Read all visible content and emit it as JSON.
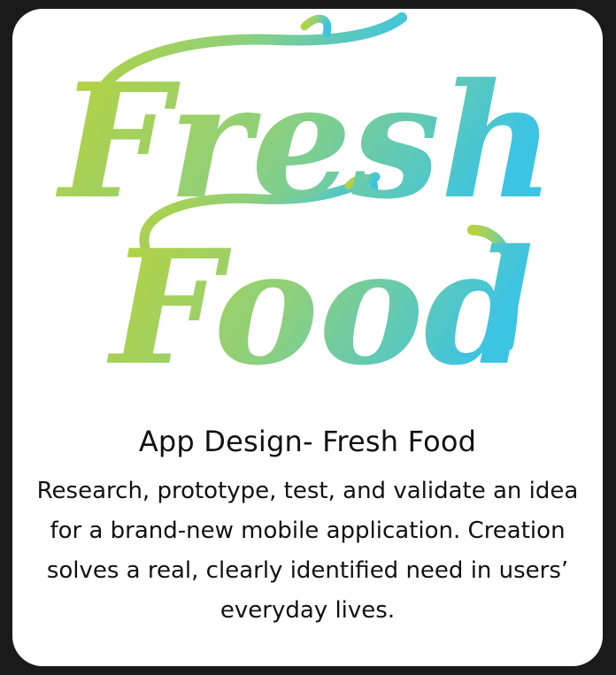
{
  "card": {
    "logo_text_line1": "Fresh",
    "logo_text_line2": "Food",
    "title": "App Design- Fresh Food",
    "description": "Research, prototype, test, and validate an idea for a brand-new mobile application. Creation solves a real, clearly identified need in users’ everyday lives."
  },
  "colors": {
    "background": "#1a1a1a",
    "card": "#ffffff",
    "logo_gradient_start": "#b9d23a",
    "logo_gradient_end": "#3cc4e3",
    "text": "#111111"
  }
}
